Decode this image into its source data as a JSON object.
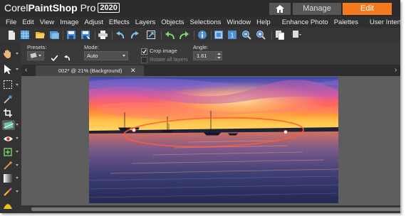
{
  "app": {
    "brand_prefix": "Corel",
    "brand_name": "PaintShop",
    "brand_suffix": " Pro",
    "year": "2020"
  },
  "workspace_tabs": {
    "home_icon": "home-icon",
    "manage": "Manage",
    "edit": "Edit",
    "active": "Edit",
    "active_color": "#f47a20"
  },
  "menu": [
    "File",
    "Edit",
    "View",
    "Image",
    "Adjust",
    "Effects",
    "Layers",
    "Objects",
    "Selections",
    "Window",
    "Help",
    "Enhance Photo",
    "Palettes",
    "User Interface"
  ],
  "tool_options": {
    "presets_label": "Presets:",
    "mode_label": "Mode:",
    "mode_value": "Auto",
    "crop_image_label": "Crop image",
    "crop_image_checked": true,
    "rotate_all_layers_label": "Rotate all layers",
    "rotate_all_layers_checked": false,
    "angle_label": "Angle:",
    "angle_value": "1.61"
  },
  "document": {
    "tab_title": "002* @  21% (Background)",
    "close_glyph": "✕"
  },
  "toolbar_icons": [
    "new-icon",
    "grid-icon",
    "open-icon",
    "browse-icon",
    "save-icon",
    "save-as-icon",
    "print-icon",
    "rotate-left-icon",
    "rotate-right-icon",
    "resize-icon",
    "undo-icon",
    "redo-icon",
    "info-icon",
    "fit-window-icon",
    "actual-size-icon",
    "zoom-out-icon",
    "zoom-in-icon",
    "copy-icon",
    "overflow-icon"
  ],
  "tool_icons": [
    "pan-icon",
    "pick-icon",
    "selection-icon",
    "eyedropper-icon",
    "crop-icon",
    "straighten-icon",
    "red-eye-icon",
    "makeover-icon",
    "paint-brush-icon",
    "fill-icon",
    "eraser-icon",
    "dodge-icon"
  ]
}
